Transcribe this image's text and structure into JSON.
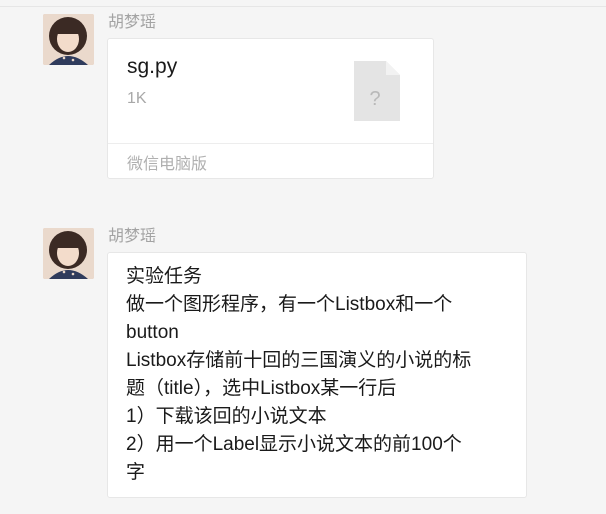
{
  "messages": [
    {
      "sender": "胡梦瑶",
      "avatar_icon": "user-avatar",
      "type": "file",
      "file": {
        "name": "sg.py",
        "size": "1K",
        "icon": "unknown-file-icon",
        "icon_glyph": "?",
        "source": "微信电脑版"
      }
    },
    {
      "sender": "胡梦瑶",
      "avatar_icon": "user-avatar",
      "type": "text",
      "lines": [
        "实验任务",
        "做一个图形程序，有一个Listbox和一个",
        "button",
        "Listbox存储前十回的三国演义的小说的标",
        "题（title），选中Listbox某一行后",
        "1）下载该回的小说文本",
        "2）用一个Label显示小说文本的前100个",
        "字"
      ]
    }
  ],
  "colors": {
    "background": "#f5f5f5",
    "bubble": "#ffffff",
    "sender_name": "#a3a3a3",
    "file_icon": "#e5e5e5"
  }
}
